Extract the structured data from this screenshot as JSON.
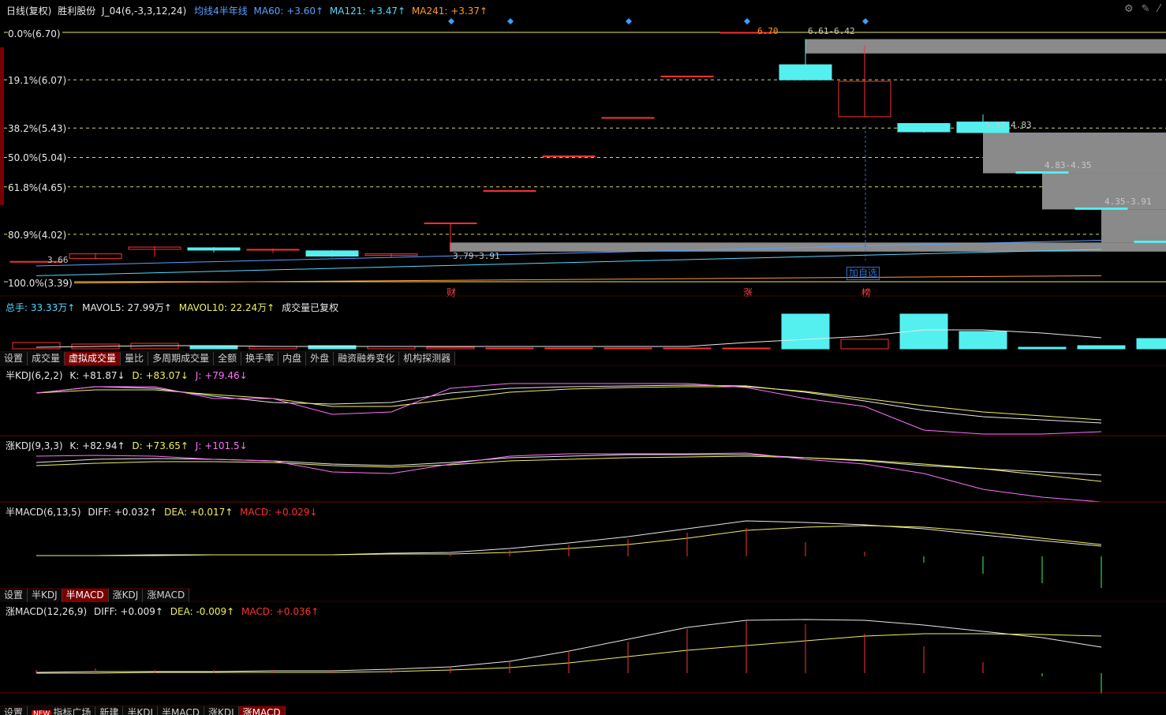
{
  "header": {
    "period": "日线(复权)",
    "stock_name": "胜利股份",
    "indicator": "J_04(6,-3,3,12,24)",
    "ma_label": "均线4半年线",
    "ma60": "MA60: +3.60↑",
    "ma121": "MA121: +3.47↑",
    "ma241": "MA241: +3.37↑"
  },
  "fib_levels": [
    {
      "label": "0.0%(6.70)",
      "price": 6.7
    },
    {
      "label": "19.1%(6.07)",
      "price": 6.07
    },
    {
      "label": "38.2%(5.43)",
      "price": 5.43
    },
    {
      "label": "50.0%(5.04)",
      "price": 5.04
    },
    {
      "label": "61.8%(4.65)",
      "price": 4.65
    },
    {
      "label": "80.9%(4.02)",
      "price": 4.02
    },
    {
      "label": "100.0%(3.39)",
      "price": 3.39
    }
  ],
  "price_annotations": {
    "high_tick": "6.70",
    "low_tick": "3.66",
    "gap1": "6.61-6.42",
    "gap2": "5.37-4.83",
    "gap3": "4.83-4.35",
    "gap4": "4.35-3.91",
    "gap5": "3.79-3.91",
    "add_watchlist": "加自选"
  },
  "event_marks": [
    "财",
    "涨",
    "榜"
  ],
  "volume_panel": {
    "total": "总手: 33.33万↑",
    "mavol5": "MAVOL5: 27.99万↑",
    "mavol10": "MAVOL10: 22.24万↑",
    "note": "成交量已复权"
  },
  "volume_tabs": [
    "设置",
    "成交量",
    "虚拟成交量",
    "量比",
    "多周期成交量",
    "全额",
    "换手率",
    "内盘",
    "外盘",
    "融资融券变化",
    "机构探测器"
  ],
  "volume_tabs_active": 2,
  "kdj1": {
    "name": "半KDJ(6,2,2)",
    "k": "K: +81.87↓",
    "d": "D: +83.07↓",
    "j": "J: +79.46↓"
  },
  "kdj2": {
    "name": "涨KDJ(9,3,3)",
    "k": "K: +82.94↑",
    "d": "D: +73.65↑",
    "j": "J: +101.5↓"
  },
  "macd1": {
    "name": "半MACD(6,13,5)",
    "diff": "DIFF: +0.032↑",
    "dea": "DEA: +0.017↑",
    "macd": "MACD: +0.029↓"
  },
  "indicator_tabs": [
    "设置",
    "半KDJ",
    "半MACD",
    "涨KDJ",
    "涨MACD"
  ],
  "indicator_tabs_active": 2,
  "macd2": {
    "name": "涨MACD(12,26,9)",
    "diff": "DIFF: +0.009↑",
    "dea": "DEA: -0.009↑",
    "macd": "MACD: +0.036↑"
  },
  "bottom_tabs": [
    "设置",
    "指标广场",
    "新建",
    "半KDJ",
    "半MACD",
    "涨KDJ",
    "涨MACD"
  ],
  "bottom_tabs_active": 6,
  "new_badge": "NEW",
  "colors": {
    "up": "#ff3030",
    "down": "#54f0f0",
    "ma60": "#5aa0ff",
    "ma121": "#54d8ff",
    "ma241": "#ff9a2e",
    "fib": "#e8e860"
  },
  "chart_data": {
    "type": "candlestick",
    "candles": [
      {
        "o": 3.66,
        "c": 3.66,
        "h": 3.66,
        "l": 3.66
      },
      {
        "o": 3.7,
        "c": 3.76,
        "h": 3.77,
        "l": 3.69
      },
      {
        "o": 3.82,
        "c": 3.85,
        "h": 3.86,
        "l": 3.72
      },
      {
        "o": 3.84,
        "c": 3.81,
        "h": 3.85,
        "l": 3.78
      },
      {
        "o": 3.81,
        "c": 3.82,
        "h": 3.83,
        "l": 3.77
      },
      {
        "o": 3.8,
        "c": 3.73,
        "h": 3.81,
        "l": 3.72
      },
      {
        "o": 3.74,
        "c": 3.76,
        "h": 3.77,
        "l": 3.72
      },
      {
        "o": 4.17,
        "c": 4.17,
        "h": 4.17,
        "l": 3.79
      },
      {
        "o": 4.6,
        "c": 4.6,
        "h": 4.6,
        "l": 4.6
      },
      {
        "o": 5.06,
        "c": 5.06,
        "h": 5.06,
        "l": 5.06
      },
      {
        "o": 5.57,
        "c": 5.57,
        "h": 5.57,
        "l": 5.57
      },
      {
        "o": 6.12,
        "c": 6.12,
        "h": 6.12,
        "l": 6.12
      },
      {
        "o": 6.7,
        "c": 6.7,
        "h": 6.7,
        "l": 6.7
      },
      {
        "o": 6.27,
        "c": 6.07,
        "h": 6.61,
        "l": 6.07
      },
      {
        "o": 5.58,
        "c": 6.05,
        "h": 6.52,
        "l": 5.58
      },
      {
        "o": 5.49,
        "c": 5.38,
        "h": 5.49,
        "l": 5.37
      },
      {
        "o": 5.51,
        "c": 5.37,
        "h": 5.61,
        "l": 5.37
      },
      {
        "o": 4.85,
        "c": 4.83,
        "h": 4.85,
        "l": 4.83
      },
      {
        "o": 4.37,
        "c": 4.35,
        "h": 4.37,
        "l": 4.35
      },
      {
        "o": 3.93,
        "c": 3.91,
        "h": 3.93,
        "l": 3.91
      }
    ]
  }
}
